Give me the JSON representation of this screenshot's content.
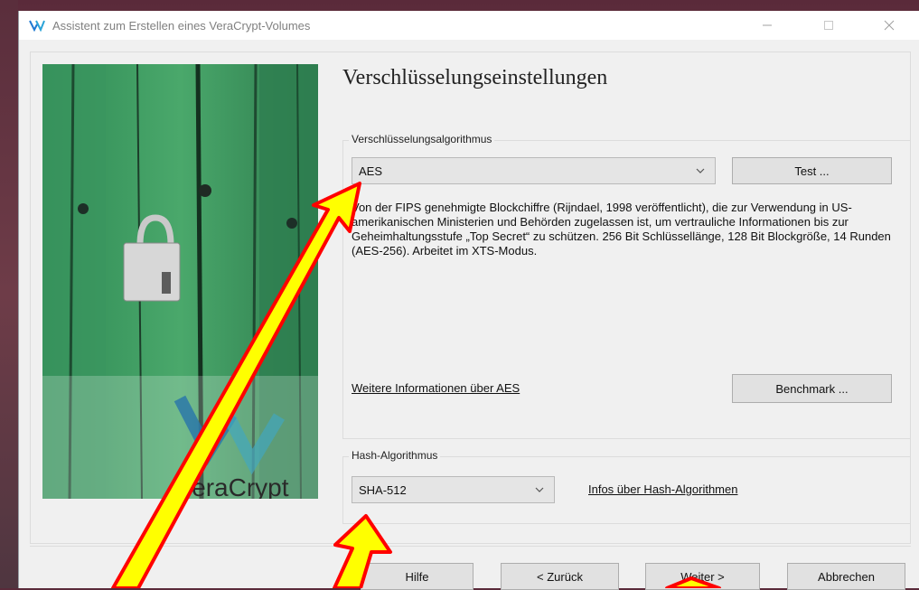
{
  "window": {
    "title": "Assistent zum Erstellen eines VeraCrypt-Volumes"
  },
  "side_image": {
    "logo_text": "VeraCrypt"
  },
  "page": {
    "title": "Verschlüsselungseinstellungen"
  },
  "encryption": {
    "group_label": "Verschlüsselungsalgorithmus",
    "selected_algorithm": "AES",
    "test_button": "Test ...",
    "description": "Von der FIPS genehmigte Blockchiffre (Rijndael, 1998 veröffentlicht), die zur Verwendung in US-amerikanischen Ministerien und Behörden zugelassen ist, um vertrauliche Informationen bis zur Geheimhaltungsstufe „Top Secret“ zu schützen. 256 Bit Schlüssellänge, 128 Bit Blockgröße, 14 Runden (AES-256). Arbeitet im XTS-Modus.",
    "more_info_link": "Weitere Informationen über AES",
    "benchmark_button": "Benchmark ..."
  },
  "hash": {
    "group_label": "Hash-Algorithmus",
    "selected_algorithm": "SHA-512",
    "info_link": "Infos über Hash-Algorithmen"
  },
  "footer": {
    "help_button": "Hilfe",
    "back_button": "< Zurück",
    "next_button": "Weiter >",
    "cancel_button": "Abbrechen"
  },
  "colors": {
    "annotation_arrow_fill": "#ffff00",
    "annotation_arrow_outline": "#ff0000",
    "door_green": "#3f9a5f"
  }
}
